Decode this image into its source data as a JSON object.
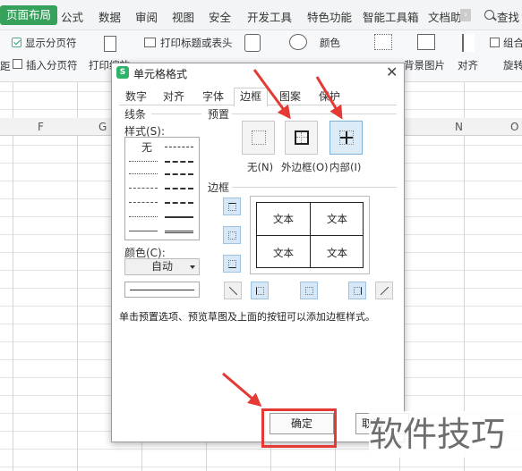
{
  "ribbon": {
    "tabs": [
      "页面布局",
      "公式",
      "数据",
      "审阅",
      "视图",
      "安全",
      "开发工具",
      "特色功能",
      "智能工具箱",
      "文档助"
    ],
    "search_label": "查找",
    "toolbar": {
      "show_page_break": "显示分页符",
      "insert_page_break": "插入分页符",
      "print_zoom": "打印缩放",
      "print_titles": "打印标题或表头",
      "color": "颜色",
      "background_image": "背景图片",
      "align": "对齐",
      "group": "组合",
      "rotate": "旋转",
      "left_edge": "距"
    }
  },
  "sheet": {
    "columns": [
      "F",
      "G",
      "N",
      "O"
    ]
  },
  "dialog": {
    "title": "单元格格式",
    "tabs": [
      "数字",
      "对齐",
      "字体",
      "边框",
      "图案",
      "保护"
    ],
    "active_tab": "边框",
    "line_section": "线条",
    "style_label": "样式(S):",
    "style_none": "无",
    "color_label": "颜色(C):",
    "color_value": "自动",
    "preset_section": "预置",
    "presets": [
      "无(N)",
      "外边框(O)",
      "内部(I)"
    ],
    "border_section": "边框",
    "preview_text": [
      "文本",
      "文本",
      "文本",
      "文本"
    ],
    "hint": "单击预置选项、预览草图及上面的按钮可以添加边框样式。",
    "ok": "确定",
    "cancel": "取消"
  },
  "watermark": "软件技巧",
  "colors": {
    "ribbon_active": "#35a15b",
    "highlight": "#e53935",
    "selected_preset": "#dcebf8"
  }
}
